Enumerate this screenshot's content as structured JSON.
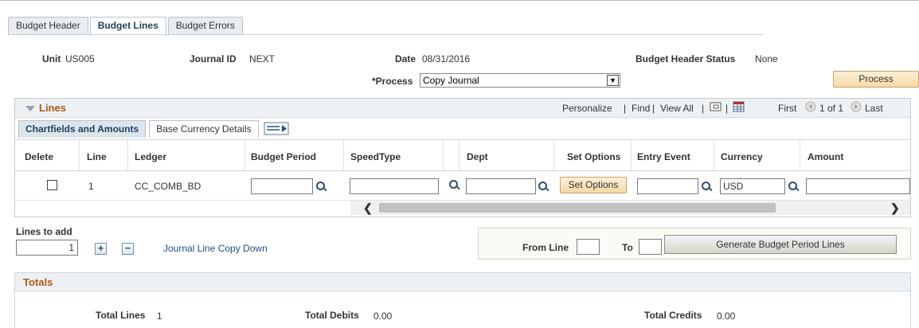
{
  "tabs": [
    {
      "label": "Budget Header",
      "active": false
    },
    {
      "label": "Budget Lines",
      "active": true
    },
    {
      "label": "Budget Errors",
      "active": false
    }
  ],
  "header": {
    "unit_label": "Unit",
    "unit_value": "US005",
    "journal_id_label": "Journal ID",
    "journal_id_value": "NEXT",
    "date_label": "Date",
    "date_value": "08/31/2016",
    "status_label": "Budget Header Status",
    "status_value": "None",
    "process_label": "*Process",
    "process_value": "Copy Journal",
    "process_button": "Process"
  },
  "lines_grid": {
    "title": "Lines",
    "personalize": "Personalize",
    "find": "Find",
    "view_all": "View All",
    "first": "First",
    "page_info": "1 of 1",
    "last": "Last",
    "subtabs": [
      {
        "label": "Chartfields and Amounts",
        "active": true
      },
      {
        "label": "Base Currency Details",
        "active": false
      }
    ],
    "columns": [
      "Delete",
      "Line",
      "Ledger",
      "Budget Period",
      "SpeedType",
      "Dept",
      "Set Options",
      "Entry Event",
      "Currency",
      "Amount"
    ],
    "rows": [
      {
        "line": "1",
        "ledger": "CC_COMB_BD",
        "budget_period": "",
        "speedtype": "",
        "dept": "",
        "set_options_button": "Set Options",
        "entry_event": "",
        "currency": "USD",
        "amount": ""
      }
    ]
  },
  "lines_to_add": {
    "label": "Lines to add",
    "value": "1",
    "copy_down_link": "Journal Line Copy Down"
  },
  "generate": {
    "from_line_label": "From Line",
    "from_line_value": "",
    "to_label": "To",
    "to_value": "",
    "button": "Generate Budget Period Lines"
  },
  "totals": {
    "title": "Totals",
    "total_lines_label": "Total Lines",
    "total_lines_value": "1",
    "total_debits_label": "Total Debits",
    "total_debits_value": "0.00",
    "total_credits_label": "Total Credits",
    "total_credits_value": "0.00"
  },
  "colors": {
    "section_title": "#b05a14",
    "link": "#1f4f8a",
    "orange_button": "#f6d9a6"
  },
  "icons": [
    "lookup-icon",
    "chevron-down-icon",
    "expand-grid-icon",
    "download-grid-icon",
    "prev-page-icon",
    "next-page-icon",
    "show-all-columns-icon",
    "add-row-icon",
    "delete-row-icon"
  ]
}
